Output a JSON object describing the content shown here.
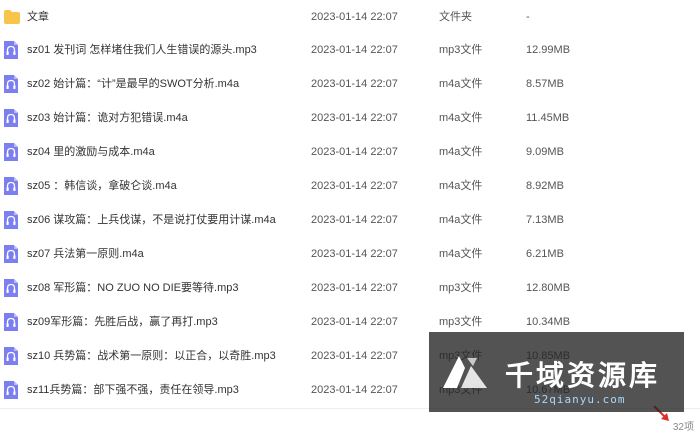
{
  "files": [
    {
      "name": "文章",
      "date": "2023-01-14 22:07",
      "type": "文件夹",
      "size": "-",
      "icon": "folder-icon"
    },
    {
      "name": "sz01 发刊词  怎样堵住我们人生错误的源头.mp3",
      "date": "2023-01-14 22:07",
      "type": "mp3文件",
      "size": "12.99MB",
      "icon": "audio-icon"
    },
    {
      "name": "sz02 始计篇：“计”是最早的SWOT分析.m4a",
      "date": "2023-01-14 22:07",
      "type": "m4a文件",
      "size": "8.57MB",
      "icon": "audio-icon"
    },
    {
      "name": "sz03 始计篇：诡对方犯错误.m4a",
      "date": "2023-01-14 22:07",
      "type": "m4a文件",
      "size": "11.45MB",
      "icon": "audio-icon"
    },
    {
      "name": "sz04 里的激励与成本.m4a",
      "date": "2023-01-14 22:07",
      "type": "m4a文件",
      "size": "9.09MB",
      "icon": "audio-icon"
    },
    {
      "name": "sz05 ：韩信谈，拿破仑谈.m4a",
      "date": "2023-01-14 22:07",
      "type": "m4a文件",
      "size": "8.92MB",
      "icon": "audio-icon"
    },
    {
      "name": "sz06 谋攻篇：上兵伐谋，不是说打仗要用计谋.m4a",
      "date": "2023-01-14 22:07",
      "type": "m4a文件",
      "size": "7.13MB",
      "icon": "audio-icon"
    },
    {
      "name": "sz07 兵法第一原则.m4a",
      "date": "2023-01-14 22:07",
      "type": "m4a文件",
      "size": "6.21MB",
      "icon": "audio-icon"
    },
    {
      "name": "sz08 军形篇：NO ZUO NO DIE要等待.mp3",
      "date": "2023-01-14 22:07",
      "type": "mp3文件",
      "size": "12.80MB",
      "icon": "audio-icon"
    },
    {
      "name": "sz09军形篇：先胜后战，赢了再打.mp3",
      "date": "2023-01-14 22:07",
      "type": "mp3文件",
      "size": "10.34MB",
      "icon": "audio-icon"
    },
    {
      "name": "sz10 兵势篇：战术第一原则：以正合，以奇胜.mp3",
      "date": "2023-01-14 22:07",
      "type": "mp3文件",
      "size": "10.85MB",
      "icon": "audio-icon"
    },
    {
      "name": "sz11兵势篇：部下强不强，责任在领导.mp3",
      "date": "2023-01-14 22:07",
      "type": "mp3文件",
      "size": "10.67MB",
      "icon": "audio-icon"
    }
  ],
  "footer": {
    "item_count": "32项"
  },
  "watermark": {
    "title": "千域资源库",
    "url": "52qianyu.com"
  },
  "colors": {
    "folder": "#f7c648",
    "audio_icon": "#7b7ff0",
    "arrow": "#d9302c"
  }
}
